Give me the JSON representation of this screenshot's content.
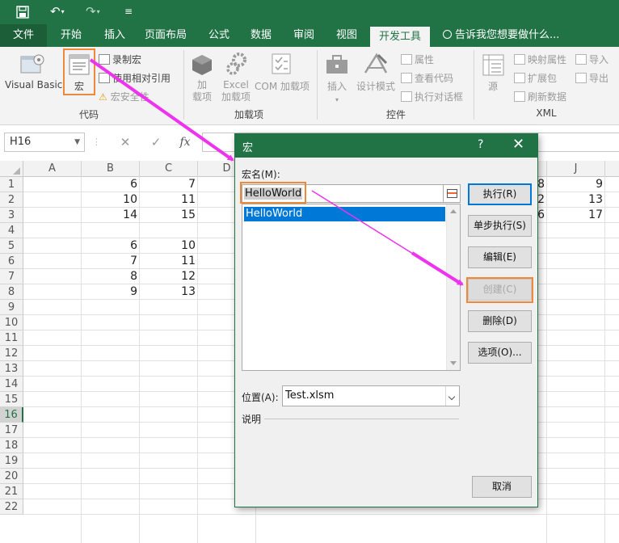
{
  "quick_access": {
    "save_icon": "save-icon",
    "undo_icon": "undo-icon",
    "redo_icon": "redo-icon",
    "customize_icon": "customize-qat-icon"
  },
  "tabs": {
    "file": "文件",
    "home": "开始",
    "insert": "插入",
    "page_layout": "页面布局",
    "formulas": "公式",
    "data": "数据",
    "review": "审阅",
    "view": "视图",
    "developer": "开发工具",
    "tell_me": "告诉我您想要做什么..."
  },
  "ribbon": {
    "code": {
      "group_label": "代码",
      "visual_basic": "Visual Basic",
      "macros": "宏",
      "record_macro": "录制宏",
      "use_relative": "使用相对引用",
      "macro_security": "宏安全性"
    },
    "addins": {
      "group_label": "加载项",
      "addins_line1": "加",
      "addins_line2": "载项",
      "excel_line1": "Excel",
      "excel_line2": "加载项",
      "com": "COM 加载项"
    },
    "controls": {
      "group_label": "控件",
      "insert": "插入",
      "design_mode": "设计模式",
      "properties": "属性",
      "view_code": "查看代码",
      "run_dialog": "执行对话框"
    },
    "xml": {
      "group_label": "XML",
      "source": "源",
      "map_properties": "映射属性",
      "expansion_packs": "扩展包",
      "refresh_data": "刷新数据",
      "import": "导入",
      "export": "导出"
    }
  },
  "formula_bar": {
    "name_box": "H16",
    "cancel": "✕",
    "enter": "✓",
    "fx": "fx"
  },
  "sheet": {
    "columns": [
      "A",
      "B",
      "C",
      "D",
      "J"
    ],
    "rows": [
      "1",
      "2",
      "3",
      "4",
      "5",
      "6",
      "7",
      "8",
      "9",
      "10",
      "11",
      "12",
      "13",
      "14",
      "15",
      "16",
      "17",
      "18",
      "19",
      "20",
      "21",
      "22"
    ],
    "selected_row": "16",
    "col_b": [
      "6",
      "10",
      "14",
      "",
      "6",
      "7",
      "8",
      "9"
    ],
    "col_c": [
      "7",
      "11",
      "15",
      "",
      "10",
      "11",
      "12",
      "13"
    ],
    "col_i_partial": [
      "8",
      "2",
      "6"
    ],
    "col_j": [
      "9",
      "13",
      "17"
    ]
  },
  "dialog": {
    "title": "宏",
    "help": "?",
    "close": "✕",
    "macro_name_label": "宏名(M):",
    "macro_name_value": "HelloWorld",
    "macro_list": [
      "HelloWorld"
    ],
    "buttons": {
      "run": "执行(R)",
      "step_into": "单步执行(S)",
      "edit": "编辑(E)",
      "create": "创建(C)",
      "delete": "删除(D)",
      "options": "选项(O)...",
      "cancel": "取消"
    },
    "location_label": "位置(A):",
    "location_value": "Test.xlsm",
    "description_label": "说明"
  },
  "annotation_color": "#f0883a",
  "arrow_color": "#ee33ee"
}
